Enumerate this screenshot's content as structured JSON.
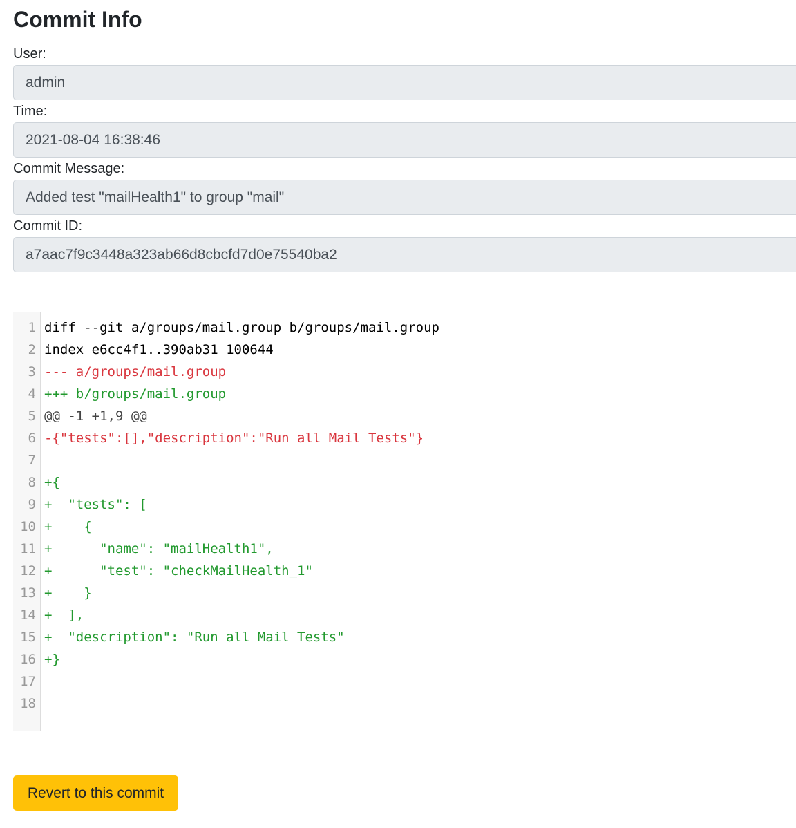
{
  "header": {
    "title": "Commit Info"
  },
  "fields": [
    {
      "label": "User:",
      "value": "admin"
    },
    {
      "label": "Time:",
      "value": "2021-08-04 16:38:46"
    },
    {
      "label": "Commit Message:",
      "value": "Added test \"mailHealth1\" to group \"mail\""
    },
    {
      "label": "Commit ID:",
      "value": "a7aac7f9c3448a323ab66d8cbcfd7d0e75540ba2"
    }
  ],
  "diff": {
    "lines": [
      {
        "num": "1",
        "text": "diff --git a/groups/mail.group b/groups/mail.group",
        "kind": "plain"
      },
      {
        "num": "2",
        "text": "index e6cc4f1..390ab31 100644",
        "kind": "plain"
      },
      {
        "num": "3",
        "text": "--- a/groups/mail.group",
        "kind": "del"
      },
      {
        "num": "4",
        "text": "+++ b/groups/mail.group",
        "kind": "add"
      },
      {
        "num": "5",
        "text": "@@ -1 +1,9 @@",
        "kind": "meta"
      },
      {
        "num": "6",
        "text": "-{\"tests\":[],\"description\":\"Run all Mail Tests\"}",
        "kind": "del"
      },
      {
        "num": "7",
        "text": "",
        "kind": "plain"
      },
      {
        "num": "8",
        "text": "+{",
        "kind": "add"
      },
      {
        "num": "9",
        "text": "+  \"tests\": [",
        "kind": "add"
      },
      {
        "num": "10",
        "text": "+    {",
        "kind": "add"
      },
      {
        "num": "11",
        "text": "+      \"name\": \"mailHealth1\",",
        "kind": "add"
      },
      {
        "num": "12",
        "text": "+      \"test\": \"checkMailHealth_1\"",
        "kind": "add"
      },
      {
        "num": "13",
        "text": "+    }",
        "kind": "add"
      },
      {
        "num": "14",
        "text": "+  ],",
        "kind": "add"
      },
      {
        "num": "15",
        "text": "+  \"description\": \"Run all Mail Tests\"",
        "kind": "add"
      },
      {
        "num": "16",
        "text": "+}",
        "kind": "add"
      },
      {
        "num": "17",
        "text": "",
        "kind": "plain"
      },
      {
        "num": "18",
        "text": "",
        "kind": "plain"
      }
    ]
  },
  "actions": {
    "revert_label": "Revert to this commit"
  },
  "colors": {
    "deleted": "#d9363e",
    "added": "#22992e",
    "button": "#ffc107",
    "readonly_input": "#e9ecef"
  }
}
